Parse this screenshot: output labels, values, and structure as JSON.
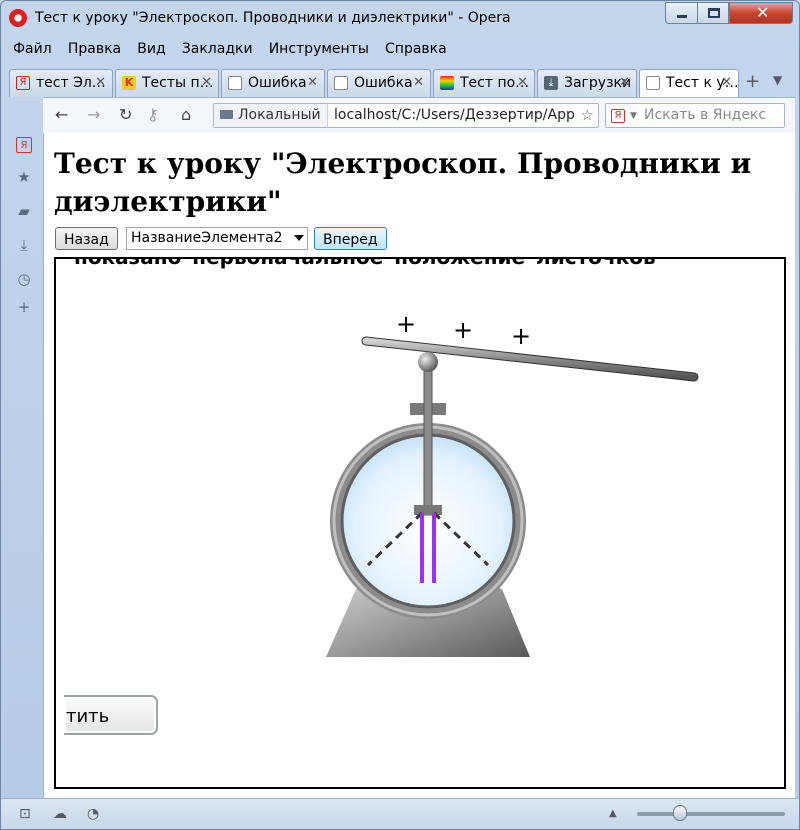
{
  "window": {
    "title": "Тест к уроку \"Электроскоп. Проводники и диэлектрики\" - Opera"
  },
  "menu": [
    "Файл",
    "Правка",
    "Вид",
    "Закладки",
    "Инструменты",
    "Справка"
  ],
  "tabs": [
    {
      "label": "тест Эл…",
      "icon": "yandex-icon",
      "color": "#d42020"
    },
    {
      "label": "Тесты п…",
      "icon": "k-icon",
      "color": "#e03030"
    },
    {
      "label": "Ошибка",
      "icon": "page-icon",
      "color": "#888888"
    },
    {
      "label": "Ошибка",
      "icon": "page-icon",
      "color": "#888888"
    },
    {
      "label": "Тест по…",
      "icon": "rainbow-icon",
      "color": "#3355cc"
    },
    {
      "label": "Загрузки",
      "icon": "download-icon",
      "color": "#556677"
    },
    {
      "label": "Тест к у…",
      "icon": "page-icon",
      "color": "#888888",
      "active": true
    }
  ],
  "toolbar": {
    "address_badge": "Локальный",
    "url": "localhost/C:/Users/Деззертир/AppD",
    "search_placeholder": "Искать в Яндекс"
  },
  "page": {
    "title": "Тест к уроку \"Электроскоп. Проводники и диэлектрики\"",
    "back_label": "Назад",
    "select_value": "НазваниеЭлемента2",
    "forward_label": "Вперед",
    "caption": "показано первоначальное положение листочков",
    "check_label": "тить"
  },
  "scene": {
    "charges": [
      "+",
      "+",
      "+"
    ],
    "leaf_color": "#9b30ff",
    "bar_color": "#808080"
  }
}
